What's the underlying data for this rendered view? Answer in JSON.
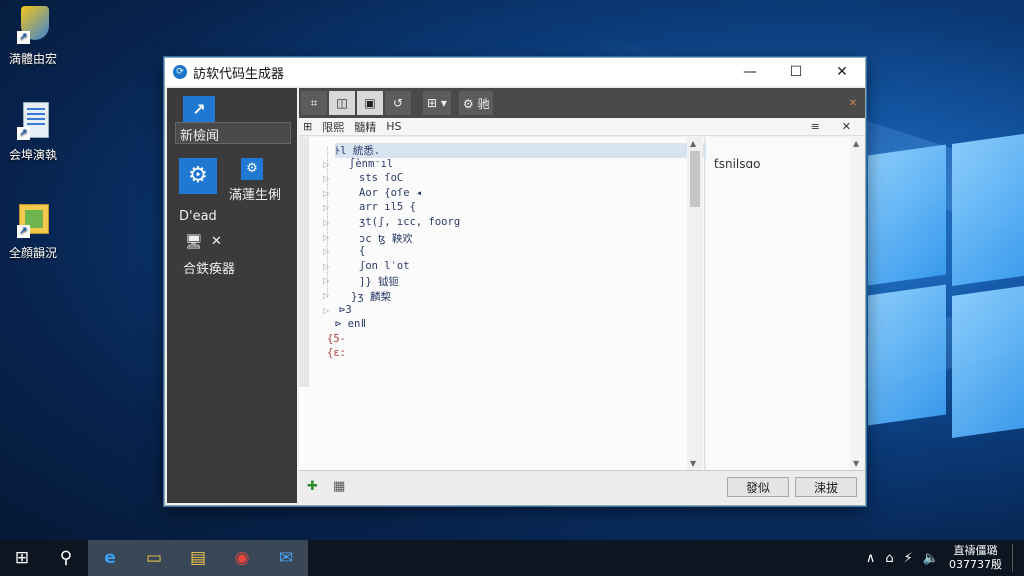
{
  "desktop": {
    "icons": [
      {
        "label": "満體由宏",
        "icon": "shield-app-icon"
      },
      {
        "label": "会埠演執",
        "icon": "document-icon"
      },
      {
        "label": "全顔韻況",
        "icon": "folder-icon"
      }
    ]
  },
  "window": {
    "title": "訪软代码生成器",
    "controls": {
      "minimize": "—",
      "maximize": "☐",
      "close": "✕"
    }
  },
  "sidebar": {
    "input_value": "新檢闻",
    "item_big_label": "滿蓮生俐",
    "section_label": "D'ead",
    "close_mark": "✕",
    "bottom_label": "合鉄痪器"
  },
  "toolbar": {
    "buttons": [
      "⌗",
      "◫",
      "▣",
      "↺",
      "⊞ ▾",
      "⚙ 驰"
    ],
    "close_mark": "✕"
  },
  "editor_header": {
    "items": [
      "⊞",
      "限熙",
      "髓精",
      "HS"
    ],
    "right": [
      "≡",
      "✕"
    ]
  },
  "code": [
    {
      "text": "ﾄl 統悉.",
      "indent": 0,
      "selected": true,
      "red": false
    },
    {
      "text": "∫ènm⁻ıl",
      "indent": 14,
      "selected": false,
      "red": false
    },
    {
      "text": "sts ſoC",
      "indent": 24,
      "selected": false,
      "red": false
    },
    {
      "text": "Aor {oſe ◂",
      "indent": 24,
      "selected": false,
      "red": false
    },
    {
      "text": "arr ıl5 {",
      "indent": 24,
      "selected": false,
      "red": false
    },
    {
      "text": "ʒt(ʃ, ıcc, foorg",
      "indent": 24,
      "selected": false,
      "red": false
    },
    {
      "text": "ɔc ꜩ 鞅欢",
      "indent": 24,
      "selected": false,
      "red": false
    },
    {
      "text": "{",
      "indent": 24,
      "selected": false,
      "red": false
    },
    {
      "text": "ʃon lˈot",
      "indent": 24,
      "selected": false,
      "red": false
    },
    {
      "text": "]}     钺钷",
      "indent": 24,
      "selected": false,
      "red": false
    },
    {
      "text": "}ʒ    麟棃",
      "indent": 16,
      "selected": false,
      "red": false
    },
    {
      "text": "⊳3",
      "indent": 4,
      "selected": false,
      "red": false
    },
    {
      "text": "⊳ enǁ",
      "indent": 0,
      "selected": false,
      "red": false
    },
    {
      "text": "{5-",
      "indent": -8,
      "selected": false,
      "red": true
    },
    {
      "text": "{ɛ:",
      "indent": -8,
      "selected": false,
      "red": true
    }
  ],
  "right_panel": {
    "text": "ƭsnilsɑo"
  },
  "footer": {
    "button_1": "發似",
    "button_2": "涑拔"
  },
  "taskbar": {
    "items": [
      {
        "name": "start-icon",
        "glyph": "⊞"
      },
      {
        "name": "search-icon",
        "glyph": "⚲"
      },
      {
        "name": "edge-icon",
        "glyph": "e"
      },
      {
        "name": "file-explorer-icon",
        "glyph": "▭"
      },
      {
        "name": "folder-icon",
        "glyph": "▤"
      },
      {
        "name": "chrome-icon",
        "glyph": "◉"
      },
      {
        "name": "mail-icon",
        "glyph": "✉"
      }
    ],
    "tray": [
      "∧",
      "⌂",
      "⚡",
      "🔈"
    ],
    "clock_line1": "直禱僵璐",
    "clock_line2": "037737殷"
  }
}
